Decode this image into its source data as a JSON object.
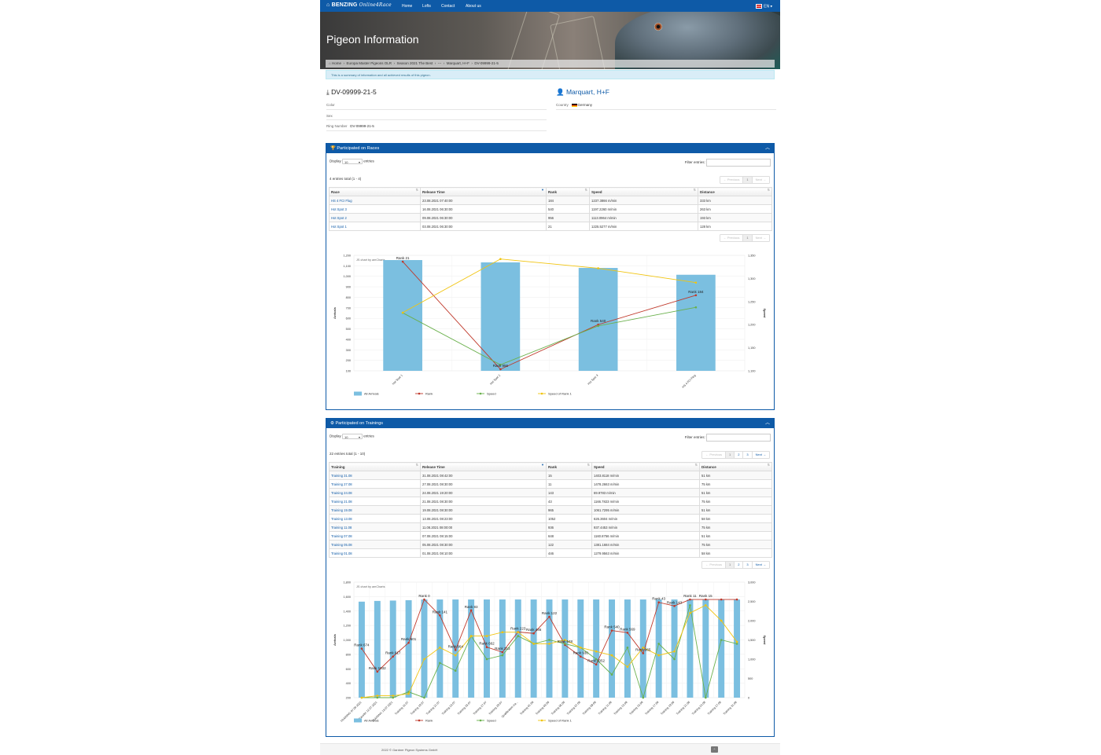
{
  "nav": {
    "brand": "BENZING",
    "brand_sub": "Online4Race",
    "links": [
      "Home",
      "Lofts",
      "Contact",
      "About us"
    ],
    "lang": "EN"
  },
  "hero": {
    "title": "Pigeon Information"
  },
  "breadcrumb": [
    "Home",
    "Europa Master Pigeons OLR",
    "Season 2021 The Best",
    "---",
    "Marquart, H+F",
    "DV-09999-21-5"
  ],
  "alert": "This is a summary of information and all achieved results of this pigeon.",
  "pigeon": {
    "ring": "DV-09999-21-5",
    "color_label": "Color",
    "sex_label": "Sex",
    "ring_label": "Ring Number",
    "ring_value": "DV-09999-21-5"
  },
  "owner": {
    "name": "Marquart, H+F",
    "country_label": "Country",
    "country": "Germany"
  },
  "races": {
    "title": "Participated on Races",
    "display": "Display",
    "display_value": "10",
    "entries": "entries",
    "filter": "Filter entries:",
    "total": "4 entries total (1 - 4)",
    "pager": [
      "← Previous",
      "1",
      "Next →"
    ],
    "columns": [
      "Race",
      "Release Time",
      "Rank",
      "Speed",
      "Distance"
    ],
    "rows": [
      [
        "HS 4 FCI Flug",
        "23.08.2021 07:40:00",
        "184",
        "1237.3866 m/min",
        "333 km"
      ],
      [
        "Hot Spot 3",
        "16.08.2021 06:30:00",
        "540",
        "1197.2260 m/min",
        "263 km"
      ],
      [
        "Hot Spot 2",
        "09.08.2021 06:30:00",
        "956",
        "1113.0964 m/min",
        "193 km"
      ],
      [
        "Hot Spot 1",
        "03.08.2021 06:30:00",
        "21",
        "1225.5277 m/min",
        "128 km"
      ]
    ]
  },
  "trainings": {
    "title": "Participated on Trainings",
    "display": "Display",
    "display_value": "10",
    "entries": "entries",
    "filter": "Filter entries:",
    "total": "22 entries total (1 - 10)",
    "pager": [
      "← Previous",
      "1",
      "2",
      "3",
      "Next →"
    ],
    "columns": [
      "Training",
      "Release Time",
      "Rank",
      "Speed",
      "Distance"
    ],
    "rows": [
      [
        "Training 31.08",
        "31.08.2021 08:42:00",
        "15",
        "1403.8118 m/min",
        "51 km"
      ],
      [
        "Training 27.08",
        "27.08.2021 08:30:00",
        "11",
        "1478.2663 m/min",
        "75 km"
      ],
      [
        "Training 24.08",
        "24.08.2021 19:20:00",
        "143",
        "69.9783 m/min",
        "51 km"
      ],
      [
        "Training 21.08",
        "21.08.2021 08:30:00",
        "43",
        "1166.7823 m/min",
        "75 km"
      ],
      [
        "Training 19.08",
        "19.08.2021 08:30:00",
        "965",
        "1061.7295 m/min",
        "51 km"
      ],
      [
        "Training 13.08",
        "13.08.2021 08:23:00",
        "1052",
        "626.3604 m/min",
        "58 km"
      ],
      [
        "Training 11.08",
        "11.08.2021 08:00:00",
        "936",
        "937.4453 m/min",
        "75 km"
      ],
      [
        "Training 07.08",
        "07.08.2021 08:15:00",
        "648",
        "1160.8756 m/min",
        "51 km"
      ],
      [
        "Training 05.08",
        "05.08.2021 08:30:00",
        "122",
        "1381.1684 m/min",
        "75 km"
      ],
      [
        "Training 01.08",
        "01.08.2021 08:10:00",
        "446",
        "1279.9563 m/min",
        "58 km"
      ]
    ]
  },
  "chart_data": [
    {
      "type": "bar",
      "credit": "JS chart by amCharts",
      "categories": [
        "Hot Spot 1",
        "Hot Spot 2",
        "Hot Spot 3",
        "HS 4 FCI Flug"
      ],
      "ylabel": "Arrivals",
      "y2label": "Speed",
      "ylim": [
        100,
        1200
      ],
      "y2lim": [
        1100,
        1350
      ],
      "yticks": [
        100,
        200,
        300,
        400,
        500,
        600,
        700,
        800,
        900,
        1000,
        1100,
        1200
      ],
      "yticks_text": [
        "100",
        "200",
        "300",
        "400",
        "500",
        "600",
        "700",
        "800",
        "900",
        "1,000",
        "1,100",
        "1,200"
      ],
      "y2ticks": [
        1100,
        1150,
        1200,
        1250,
        1300,
        1350
      ],
      "y2ticks_text": [
        "1,100",
        "1,150",
        "1,200",
        "1,250",
        "1,300",
        "1,350"
      ],
      "series": [
        {
          "name": "All Arrivals",
          "kind": "bar",
          "axis": "left",
          "color": "#7bbfe0",
          "values": [
            1155,
            1133,
            1080,
            1015
          ]
        },
        {
          "name": "Rank",
          "kind": "line",
          "axis": "left",
          "color": "#c0392b",
          "values": [
            1140,
            115,
            540,
            820
          ]
        },
        {
          "name": "Speed",
          "kind": "line",
          "axis": "right",
          "color": "#6ab04c",
          "values": [
            1225.5,
            1113.1,
            1197.2,
            1237.4
          ]
        },
        {
          "name": "Speed of Rank 1",
          "kind": "line",
          "axis": "right",
          "color": "#f1c40f",
          "values": [
            1226,
            1342,
            1322,
            1291
          ]
        }
      ],
      "rank_labels": [
        "Rank 21",
        "Rank 956",
        "Rank 540",
        "Rank 184"
      ]
    },
    {
      "type": "bar",
      "credit": "JS chart by amCharts",
      "categories": [
        "TRAINING 07.06.2021",
        "Transfer 12.07.2021",
        "TRAINING 13.07.2021",
        "Training 16.07",
        "Training 19.07",
        "Training 21.07",
        "Training 23.07",
        "Training 25.07",
        "Training 27.07",
        "Training 29.07",
        "Qualification tra...",
        "Training 01.08",
        "Training 03.08",
        "Training 05.08",
        "Training 07.08",
        "Training 09.08",
        "Training 11.08",
        "Training 13.08",
        "Training 15.08",
        "Training 17.08",
        "Training 19.08",
        "Training 21.08",
        "Training 24.08",
        "Training 27.08",
        "Training 31.08"
      ],
      "ylabel": "Arrivals",
      "y2label": "Speed",
      "ylim": [
        200,
        1800
      ],
      "y2lim": [
        0,
        3000
      ],
      "yticks": [
        200,
        400,
        600,
        800,
        1000,
        1200,
        1400,
        1600,
        1800
      ],
      "yticks_text": [
        "200",
        "400",
        "600",
        "800",
        "1,000",
        "1,200",
        "1,400",
        "1,600",
        "1,800"
      ],
      "y2ticks": [
        0,
        500,
        1000,
        1500,
        2000,
        2500,
        3000
      ],
      "y2ticks_text": [
        "0",
        "500",
        "1,000",
        "1,500",
        "2,000",
        "2,500",
        "3,000"
      ],
      "series": [
        {
          "name": "All Arrivals",
          "kind": "bar",
          "axis": "left",
          "color": "#7bbfe0",
          "values": [
            1530,
            1540,
            1545,
            1550,
            1560,
            1560,
            1560,
            1560,
            1560,
            1560,
            1560,
            1560,
            1560,
            1560,
            1560,
            1560,
            1560,
            1560,
            1560,
            1560,
            1560,
            1560,
            1560,
            1560,
            1560
          ]
        },
        {
          "name": "Rank",
          "kind": "line",
          "axis": "left",
          "color": "#c0392b",
          "values": [
            880,
            560,
            770,
            960,
            1560,
            1340,
            860,
            1410,
            900,
            830,
            1110,
            1090,
            1320,
            930,
            770,
            660,
            1130,
            1100,
            815,
            1520,
            1470,
            1560,
            1560,
            1560,
            1560
          ]
        },
        {
          "name": "Speed",
          "kind": "line",
          "axis": "right",
          "color": "#6ab04c",
          "values": [
            0,
            0,
            0,
            150,
            0,
            900,
            700,
            1600,
            1000,
            1100,
            1600,
            1400,
            1500,
            1400,
            1300,
            1000,
            600,
            1300,
            0,
            1400,
            1000,
            2400,
            0,
            1500,
            1400
          ]
        },
        {
          "name": "Speed of Rank 1",
          "kind": "line",
          "axis": "right",
          "color": "#f1c40f",
          "values": [
            0,
            50,
            50,
            100,
            1000,
            1300,
            1100,
            1600,
            1600,
            1700,
            1700,
            1400,
            1400,
            1500,
            1300,
            1200,
            1100,
            800,
            1300,
            1100,
            1200,
            2200,
            2400,
            2000,
            1450
          ]
        }
      ],
      "rank_labels": [
        {
          "i": 0,
          "text": "Rank 674"
        },
        {
          "i": 1,
          "text": "Rank 1032"
        },
        {
          "i": 2,
          "text": "Rank 617"
        },
        {
          "i": 3,
          "text": "Rank 601"
        },
        {
          "i": 4,
          "text": "Rank 0"
        },
        {
          "i": 5,
          "text": "Rank 141"
        },
        {
          "i": 6,
          "text": "Rank 964"
        },
        {
          "i": 7,
          "text": "Rank 83"
        },
        {
          "i": 8,
          "text": "Rank 662"
        },
        {
          "i": 9,
          "text": "Rank 313"
        },
        {
          "i": 10,
          "text": "Rank 223"
        },
        {
          "i": 11,
          "text": "Rank 446"
        },
        {
          "i": 12,
          "text": "Rank 122"
        },
        {
          "i": 13,
          "text": "Rank 648"
        },
        {
          "i": 14,
          "text": "Rank 930"
        },
        {
          "i": 15,
          "text": "Rank 1052"
        },
        {
          "i": 16,
          "text": "Rank 540"
        },
        {
          "i": 17,
          "text": "Rank 569"
        },
        {
          "i": 18,
          "text": "Rank 965"
        },
        {
          "i": 19,
          "text": "Rank 43"
        },
        {
          "i": 20,
          "text": "Rank 143"
        },
        {
          "i": 21,
          "text": "Rank 11"
        },
        {
          "i": 22,
          "text": "Rank 15"
        }
      ]
    }
  ],
  "footer": {
    "text": "2022 © Gardner Pigeon Systems GmbH",
    "button": "^"
  }
}
